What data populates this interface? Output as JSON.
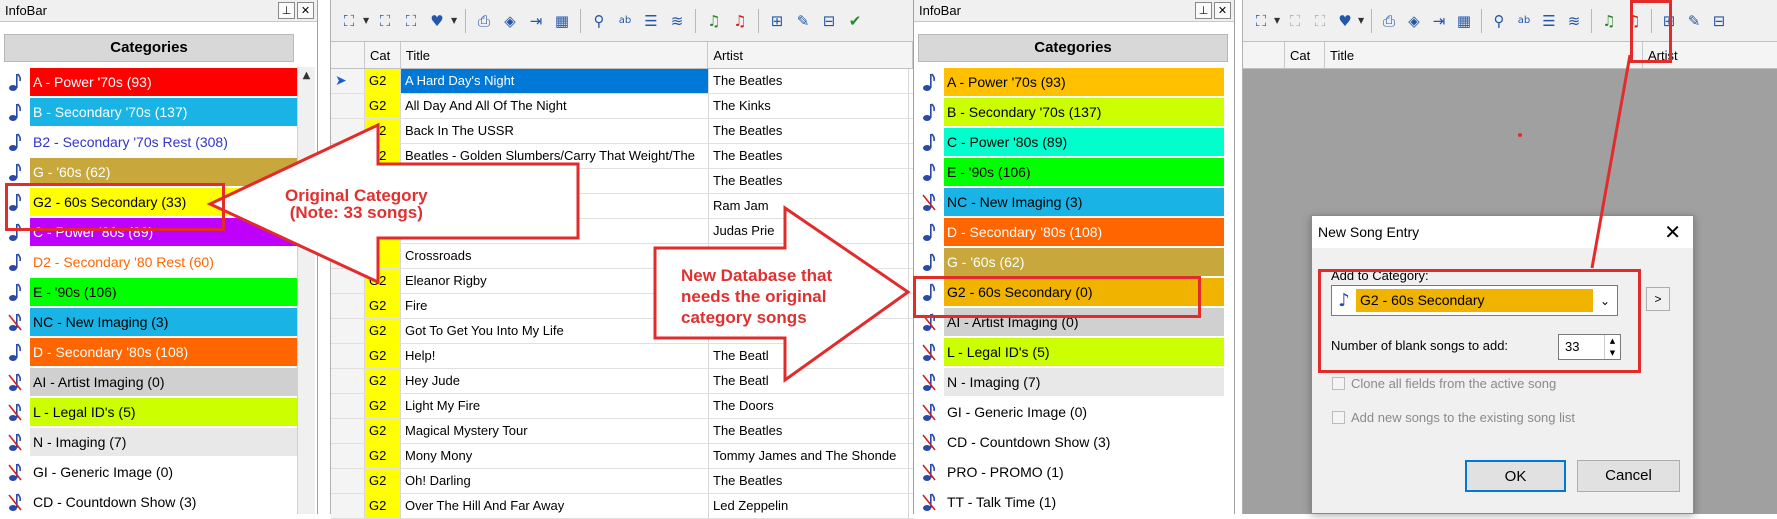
{
  "left_infobar": {
    "title": "InfoBar",
    "header": "Categories",
    "categories": [
      {
        "label": "A - Power '70s  (93)",
        "bg": "#ff0000",
        "fg": "#ffffff",
        "icon": "note"
      },
      {
        "label": "B - Secondary '70s  (137)",
        "bg": "#1ab3e6",
        "fg": "#ffffff",
        "icon": "note"
      },
      {
        "label": "B2 - Secondary '70s Rest  (308)",
        "bg": "#ffffff",
        "fg": "#3333cc",
        "icon": "note"
      },
      {
        "label": "G - '60s  (62)",
        "bg": "#c8a83c",
        "fg": "#ffffff",
        "icon": "note"
      },
      {
        "label": "G2 - 60s Secondary  (33)",
        "bg": "#ffff00",
        "fg": "#000000",
        "icon": "note"
      },
      {
        "label": "C - Power '80s  (89)",
        "bg": "#c000ff",
        "fg": "#ffffff",
        "icon": "note"
      },
      {
        "label": "D2 - Secondary '80 Rest  (60)",
        "bg": "#ffffff",
        "fg": "#ff6600",
        "icon": "note"
      },
      {
        "label": "E - '90s  (106)",
        "bg": "#00ff00",
        "fg": "#000000",
        "icon": "note"
      },
      {
        "label": "NC - New Imaging  (3)",
        "bg": "#1ab3e6",
        "fg": "#000000",
        "icon": "note-crossed"
      },
      {
        "label": "D - Secondary '80s  (108)",
        "bg": "#ff6600",
        "fg": "#ffffff",
        "icon": "note"
      },
      {
        "label": "AI - Artist Imaging  (0)",
        "bg": "#d0d0d0",
        "fg": "#000000",
        "icon": "note-crossed"
      },
      {
        "label": "L - Legal ID's  (5)",
        "bg": "#ccff00",
        "fg": "#000000",
        "icon": "note-crossed"
      },
      {
        "label": "N - Imaging  (7)",
        "bg": "#e8e8e8",
        "fg": "#000000",
        "icon": "note-crossed"
      },
      {
        "label": "GI - Generic Image  (0)",
        "bg": "#ffffff",
        "fg": "#000000",
        "icon": "note-crossed"
      },
      {
        "label": "CD - Countdown Show  (3)",
        "bg": "#ffffff",
        "fg": "#000000",
        "icon": "note-crossed"
      }
    ]
  },
  "song_grid": {
    "columns": [
      "Cat",
      "Title",
      "Artist"
    ],
    "rows": [
      {
        "cat": "G2",
        "title": "A Hard Day's Night",
        "artist": "The Beatles",
        "selected": true
      },
      {
        "cat": "G2",
        "title": "All Day And All Of The Night",
        "artist": "The Kinks"
      },
      {
        "cat": "G2",
        "title": "Back In The USSR",
        "artist": "The Beatles"
      },
      {
        "cat": "G2",
        "title": "Beatles - Golden Slumbers/Carry That Weight/The",
        "artist": "The Beatles"
      },
      {
        "cat": "",
        "title": "",
        "artist": "The Beatles"
      },
      {
        "cat": "",
        "title": "e)",
        "artist": "Ram Jam"
      },
      {
        "cat": "",
        "title": "",
        "artist": "Judas Prie"
      },
      {
        "cat": "",
        "title": "Crossroads",
        "artist": ""
      },
      {
        "cat": "G2",
        "title": "Eleanor Rigby",
        "artist": ""
      },
      {
        "cat": "G2",
        "title": "Fire",
        "artist": ""
      },
      {
        "cat": "G2",
        "title": "Got To Get You Into My Life",
        "artist": ""
      },
      {
        "cat": "G2",
        "title": "Help!",
        "artist": "The Beatl"
      },
      {
        "cat": "G2",
        "title": "Hey Jude",
        "artist": "The Beatl"
      },
      {
        "cat": "G2",
        "title": "Light My Fire",
        "artist": "The Doors"
      },
      {
        "cat": "G2",
        "title": "Magical Mystery Tour",
        "artist": "The Beatles"
      },
      {
        "cat": "G2",
        "title": "Mony Mony",
        "artist": "Tommy James and The Shonde"
      },
      {
        "cat": "G2",
        "title": "Oh! Darling",
        "artist": "The Beatles"
      },
      {
        "cat": "G2",
        "title": "Over The Hill And Far Away",
        "artist": "Led Zeppelin"
      }
    ]
  },
  "right_infobar": {
    "title": "InfoBar",
    "header": "Categories",
    "categories": [
      {
        "label": "A - Power '70s  (93)",
        "bg": "#ffc000",
        "fg": "#000000",
        "icon": "note"
      },
      {
        "label": "B - Secondary '70s  (137)",
        "bg": "#ccff00",
        "fg": "#000000",
        "icon": "note"
      },
      {
        "label": "C - Power '80s  (89)",
        "bg": "#00ffcc",
        "fg": "#000000",
        "icon": "note"
      },
      {
        "label": "E - '90s  (106)",
        "bg": "#00ff00",
        "fg": "#000000",
        "icon": "note"
      },
      {
        "label": "NC - New Imaging  (3)",
        "bg": "#1ab3e6",
        "fg": "#000000",
        "icon": "note-crossed"
      },
      {
        "label": "D - Secondary '80s  (108)",
        "bg": "#ff6600",
        "fg": "#ffffff",
        "icon": "note"
      },
      {
        "label": "G - '60s  (62)",
        "bg": "#c8a83c",
        "fg": "#ffffff",
        "icon": "note"
      },
      {
        "label": "G2 - 60s Secondary  (0)",
        "bg": "#f0b400",
        "fg": "#000000",
        "icon": "note"
      },
      {
        "label": "AI - Artist Imaging  (0)",
        "bg": "#d0d0d0",
        "fg": "#000000",
        "icon": "note-crossed"
      },
      {
        "label": "L - Legal ID's  (5)",
        "bg": "#ccff00",
        "fg": "#000000",
        "icon": "note-crossed"
      },
      {
        "label": "N - Imaging  (7)",
        "bg": "#e8e8e8",
        "fg": "#000000",
        "icon": "note-crossed"
      },
      {
        "label": "GI - Generic Image  (0)",
        "bg": "#ffffff",
        "fg": "#000000",
        "icon": "note-crossed"
      },
      {
        "label": "CD - Countdown Show  (3)",
        "bg": "#ffffff",
        "fg": "#000000",
        "icon": "note-crossed"
      },
      {
        "label": "PRO - PROMO  (1)",
        "bg": "#ffffff",
        "fg": "#000000",
        "icon": "note-crossed"
      },
      {
        "label": "TT - Talk Time  (1)",
        "bg": "#ffffff",
        "fg": "#000000",
        "icon": "note-crossed"
      }
    ]
  },
  "right_grid": {
    "columns": [
      "Cat",
      "Title",
      "Artist"
    ]
  },
  "dialog": {
    "title": "New Song Entry",
    "add_to_category_label": "Add to Category:",
    "category_value": "G2 - 60s Secondary",
    "category_color": "#f0b400",
    "blank_songs_label": "Number of blank songs to add:",
    "blank_songs_value": "33",
    "clone_label": "Clone all fields from the active song",
    "add_existing_label": "Add new songs to the existing song list",
    "ok": "OK",
    "cancel": "Cancel",
    "more_button": ">"
  },
  "annotations": {
    "original_line1": "Original Category",
    "original_line2": "(Note: 33 songs)",
    "new_db_line1": "New Database that",
    "new_db_line2": "needs the original",
    "new_db_line3": "category songs",
    "accent_color": "#e22b2b"
  }
}
